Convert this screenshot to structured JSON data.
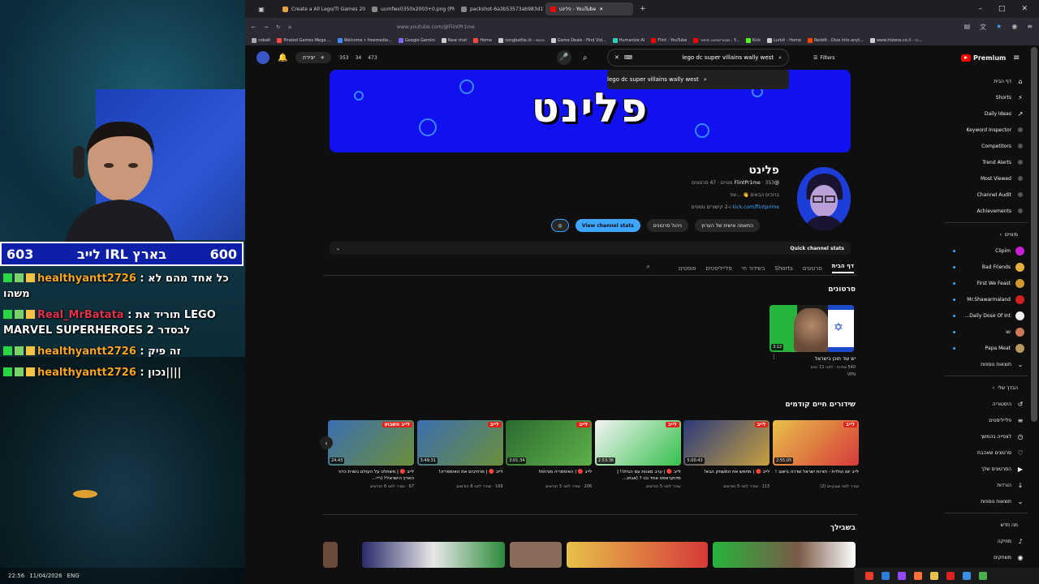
{
  "stream": {
    "score": {
      "left": "603",
      "title": "לייב IRL בארץ",
      "right": "600"
    },
    "chat": [
      {
        "user": "healthyantt2726",
        "sep": " : ",
        "msg": "כל אחד מהם לא משהו",
        "user_color": "orange"
      },
      {
        "user": "Real_MrBatata",
        "sep": " : ",
        "msg": "תוריד את LEGO MARVEL SUPERHEROES 2 לבסדר",
        "user_color": "red"
      },
      {
        "user": "healthyantt2726",
        "sep": " : ",
        "msg": "זה פיק",
        "user_color": "orange"
      },
      {
        "user": "healthyantt2726",
        "sep": " : ",
        "msg": "נכון||||",
        "user_color": "orange"
      }
    ],
    "taskbar": {
      "time": "22:56",
      "date": "11/04/2026",
      "lang": "ENG"
    }
  },
  "browser": {
    "tabs": [
      {
        "label": "Create a All Lego/TI Games 20...",
        "color": "#e8a33c",
        "active": false
      },
      {
        "label": "uumfwx0350x2003+0.png (PNG Im...",
        "color": "#888",
        "active": false
      },
      {
        "label": "packshot-6a3b53573ab983d115ee...",
        "color": "#888",
        "active": false
      },
      {
        "label": "פלינט - YouTube",
        "color": "#ff0000",
        "active": true
      }
    ],
    "new_tab": "+",
    "url": "www.youtube.com/@FlintPr1me",
    "bookmarks": [
      {
        "label": "cobalt",
        "color": "#aaa"
      },
      {
        "label": "Pirated Games Mega ...",
        "color": "#ff4444"
      },
      {
        "label": "Welcome • freemedia...",
        "color": "#4488ff"
      },
      {
        "label": "Google Gemini",
        "color": "#7b68ee"
      },
      {
        "label": "New chat",
        "color": "#ccc"
      },
      {
        "label": "Home",
        "color": "#f44"
      },
      {
        "label": "songbattle.io - נינופו",
        "color": "#ccc"
      },
      {
        "label": "Game Deals - Find Vid...",
        "color": "#ccc"
      },
      {
        "label": "Humanize AI",
        "color": "#2dd4bf"
      },
      {
        "label": "Flint - YouTube",
        "color": "#f00"
      },
      {
        "label": "סטוריטייננג סיפור - Y...",
        "color": "#f00"
      },
      {
        "label": "Kick",
        "color": "#53fc18"
      },
      {
        "label": "Lurkit - Home",
        "color": "#ccc"
      },
      {
        "label": "Reddit - Dive into anyt...",
        "color": "#ff4500"
      },
      {
        "label": "www.htzone.co.il - הי...",
        "color": "#ccc"
      }
    ]
  },
  "yt": {
    "header": {
      "create": "יצירה",
      "ext_stats": [
        "353",
        "34",
        "473"
      ],
      "search_value": "lego dc super villains wally west",
      "suggestion": "lego dc super villains wally west",
      "filters": "Filters",
      "premium": "Premium"
    },
    "channel": {
      "banner_text": "פלינט",
      "name": "פלינט",
      "handle": "@FlintPr1me",
      "meta": "353 מנויים · 47 סרטונים",
      "desc": "ברוכים הבאים 👋 ...עוד",
      "link": "kick.com/flintprime",
      "link_suffix": "ו-2 קישורים נוספים",
      "buttons": {
        "customize": "התאמה אישית של הערוץ",
        "manage": "ניהול סרטונים",
        "stats": "View channel stats"
      },
      "quick_stats": "Quick channel stats"
    },
    "tabs": [
      "דף הבית",
      "סרטונים",
      "Shorts",
      "בשידור חי",
      "פלייליסטים",
      "פוסטים"
    ],
    "sections": {
      "videos": "סרטונים",
      "lives": "שידורים חיים קודמים",
      "foryou": "בשבילך"
    },
    "featured": {
      "duration": "3:12",
      "title": "יש עוד תוכן בישראל",
      "stats": "540 צפיות · לפני 11 ימים",
      "badge": "VPN"
    },
    "live_cards": [
      {
        "duration": "2:55:05",
        "title": "לייב יום הולדת - חורות ישראל שדרה בישוב !",
        "stats": "שודר לפני שבועיים (2)",
        "colors": [
          "#e8c14a",
          "#d63a3a"
        ],
        "badge": "לייב"
      },
      {
        "duration": "5:00:43",
        "title": "לייב 🔴 | מחפש את המשחק הבא!",
        "stats": "115 · שודר לפני 5 חודשים",
        "colors": [
          "#2a3a7a",
          "#c8a040"
        ],
        "badge": "לייב"
      },
      {
        "duration": "2:53:36",
        "title": "לייב 🔴 | ערב מצנות עם הבית!! | מיינקראפט אחד נכו ? (אנחנ...",
        "stats": "שודר לפני 5 חודשים",
        "colors": [
          "#f4f4f4",
          "#35c04c"
        ],
        "badge": "לייב"
      },
      {
        "duration": "3:01:34",
        "title": "לייב 🔴 | האימפריה מורחת!",
        "stats": "206 · שודר לפני 5 חודשים",
        "colors": [
          "#2b6a2f",
          "#5fb04a"
        ],
        "badge": "לייב"
      },
      {
        "duration": "3:49:31",
        "title": "לייב 🔴 | מרחיבים את האימפריה!",
        "stats": "169 · שודר לפני 6 חודשים",
        "colors": [
          "#3b6fb0",
          "#6b8f3a"
        ],
        "badge": "לייב"
      },
      {
        "duration": "24:43",
        "title": "לייב 🔴 | משתלט על העולם בשרת כדור הארץ הישראלי! (ריי...",
        "stats": "67 · שודר לפני 6 חודשים",
        "colors": [
          "#3b6fb0",
          "#6b8f3a"
        ],
        "badge": "לייב השבוע"
      }
    ],
    "sidebar": {
      "main": [
        {
          "label": "דף הבית",
          "icon": "⌂",
          "name": "home"
        },
        {
          "label": "Shorts",
          "icon": "⚡",
          "name": "shorts"
        },
        {
          "label": "Daily Ideas",
          "icon": "↗",
          "name": "daily-ideas"
        },
        {
          "label": "Keyword Inspector",
          "icon": "",
          "name": "keyword-inspector"
        },
        {
          "label": "Competitors",
          "icon": "",
          "name": "competitors"
        },
        {
          "label": "Trend Alerts",
          "icon": "",
          "name": "trend-alerts"
        },
        {
          "label": "Most Viewed",
          "icon": "",
          "name": "most-viewed"
        },
        {
          "label": "Channel Audit",
          "icon": "",
          "name": "channel-audit"
        },
        {
          "label": "Achievements",
          "icon": "",
          "name": "achievements"
        }
      ],
      "subs_title": "מינויים",
      "subs": [
        {
          "label": "Clipim",
          "color": "#c81fd6"
        },
        {
          "label": "Bad Friends",
          "color": "#e8b040"
        },
        {
          "label": "First We Feast",
          "color": "#d09a30"
        },
        {
          "label": "Mr.Shawarmaland",
          "color": "#d02020"
        },
        {
          "label": "Daily Dose Of Int...",
          "color": "#f0f0f0"
        },
        {
          "label": "שו",
          "color": "#c87a5a"
        },
        {
          "label": "Papa Meat",
          "color": "#b89860"
        }
      ],
      "show_more": "תוצאות נוספות",
      "you_title": "הבדך שלי",
      "you": [
        {
          "label": "היסטוריה",
          "icon": "↺"
        },
        {
          "label": "פלייליסטים",
          "icon": "≡"
        },
        {
          "label": "לצפייה בהמשך",
          "icon": "◷"
        },
        {
          "label": "סרטונים שאהבת",
          "icon": "♡"
        },
        {
          "label": "הסרטונים שלך",
          "icon": "▶"
        },
        {
          "label": "הורדות",
          "icon": "↓"
        },
        {
          "label": "תוצאות נוספות",
          "icon": "⌄"
        }
      ],
      "new_title": "מה חדש",
      "new": [
        {
          "label": "מוזיקה",
          "icon": "♪"
        },
        {
          "label": "משחקים",
          "icon": "◉"
        }
      ]
    }
  }
}
